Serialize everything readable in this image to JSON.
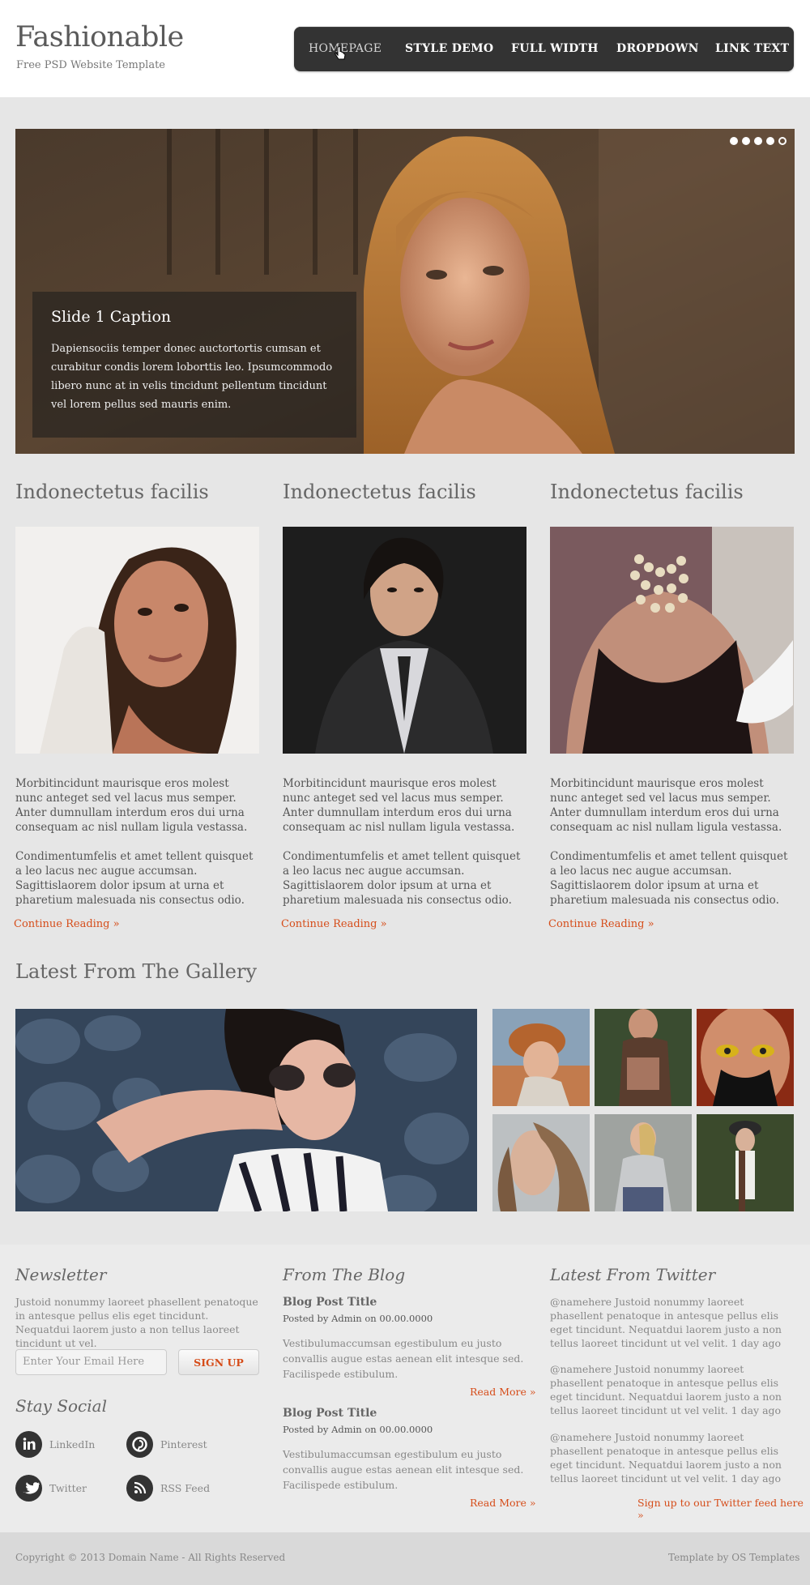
{
  "header": {
    "logo": "Fashionable",
    "tagline": "Free PSD Website Template",
    "nav": [
      "HOMEPAGE",
      "STYLE DEMO",
      "FULL WIDTH",
      "DROPDOWN",
      "LINK TEXT"
    ]
  },
  "slider": {
    "caption_title": "Slide 1 Caption",
    "caption_text": "Dapiensociis temper donec auctortortis cumsan et curabitur condis lorem loborttis leo. Ipsumcommodo libero nunc at in velis tincidunt pellentum tincidunt vel lorem pellus sed mauris enim."
  },
  "columns": [
    {
      "title": "Indonectetus facilis",
      "p1": "Morbitincidunt maurisque eros molest nunc anteget sed vel lacus mus semper. Anter dumnullam interdum eros dui urna consequam ac nisl nullam ligula vestassa.",
      "p2": "Condimentumfelis et amet tellent quisquet a leo lacus nec augue accumsan. Sagittislaorem dolor ipsum at urna et pharetium malesuada nis consectus odio.",
      "link": "Continue Reading »"
    },
    {
      "title": "Indonectetus facilis",
      "p1": "Morbitincidunt maurisque eros molest nunc anteget sed vel lacus mus semper. Anter dumnullam interdum eros dui urna consequam ac nisl nullam ligula vestassa.",
      "p2": "Condimentumfelis et amet tellent quisquet a leo lacus nec augue accumsan. Sagittislaorem dolor ipsum at urna et pharetium malesuada nis consectus odio.",
      "link": "Continue Reading »"
    },
    {
      "title": "Indonectetus facilis",
      "p1": "Morbitincidunt maurisque eros molest nunc anteget sed vel lacus mus semper. Anter dumnullam interdum eros dui urna consequam ac nisl nullam ligula vestassa.",
      "p2": "Condimentumfelis et amet tellent quisquet a leo lacus nec augue accumsan. Sagittislaorem dolor ipsum at urna et pharetium malesuada nis consectus odio.",
      "link": "Continue Reading »"
    }
  ],
  "gallery": {
    "title": "Latest From The Gallery"
  },
  "newsletter": {
    "title": "Newsletter",
    "text": "Justoid nonummy laoreet phasellent penatoque in antesque pellus elis eget tincidunt. Nequatdui laorem justo a non tellus laoreet tincidunt ut vel.",
    "placeholder": "Enter Your Email Here",
    "button": "SIGN UP"
  },
  "social": {
    "title": "Stay Social",
    "items": [
      "LinkedIn",
      "Pinterest",
      "Twitter",
      "RSS Feed"
    ]
  },
  "blog": {
    "title": "From The Blog",
    "posts": [
      {
        "title": "Blog Post Title",
        "meta_pre": "Posted by",
        "author": "Admin",
        "meta_mid": "on",
        "date": "00.00.0000",
        "text": "Vestibulumaccumsan egestibulum eu justo convallis augue estas aenean elit intesque sed. Facilispede estibulum.",
        "more": "Read More »"
      },
      {
        "title": "Blog Post Title",
        "meta_pre": "Posted by",
        "author": "Admin",
        "meta_mid": "on",
        "date": "00.00.0000",
        "text": "Vestibulumaccumsan egestibulum eu justo convallis augue estas aenean elit intesque sed. Facilispede estibulum.",
        "more": "Read More »"
      }
    ]
  },
  "twitter": {
    "title": "Latest From Twitter",
    "tweets": [
      "@namehere Justoid nonummy laoreet phasellent penatoque in antesque pellus elis eget tincidunt. Nequatdui laorem justo a non tellus laoreet tincidunt ut vel velit.  1 day ago",
      "@namehere Justoid nonummy laoreet phasellent penatoque in antesque pellus elis eget tincidunt. Nequatdui laorem justo a non tellus laoreet tincidunt ut vel velit. 1 day ago",
      "@namehere Justoid nonummy laoreet phasellent penatoque in antesque pellus elis eget tincidunt. Nequatdui laorem justo a non tellus laoreet tincidunt ut vel velit.  1 day ago"
    ],
    "follow": "Sign up to our Twitter feed here »"
  },
  "footer": {
    "copyright": "Copyright © 2013 Domain Name - All Rights Reserved",
    "credit": "Template by OS Templates"
  },
  "colors": {
    "accent": "#d64d1a",
    "nav_bg": "#333333",
    "page_bg": "#e6e6e6"
  }
}
